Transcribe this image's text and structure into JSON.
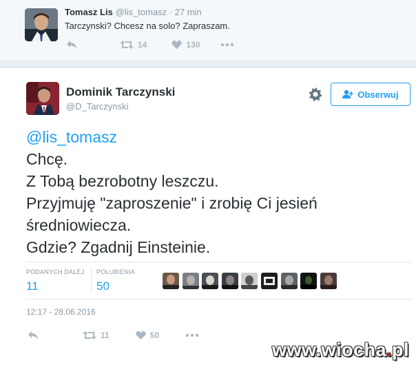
{
  "reply_tweet": {
    "author_name": "Tomasz Lis",
    "author_handle": "@lis_tomasz",
    "time": "· 27 min",
    "text": "Tarczynski? Chcesz na solo? Zapraszam.",
    "retweets": "14",
    "likes": "130"
  },
  "main_tweet": {
    "author_name": "Dominik Tarczynski",
    "author_handle": "@D_Tarczynski",
    "follow_label": "Obserwuj",
    "mention": "@lis_tomasz",
    "lines": [
      "Chcę.",
      "Z Tobą bezrobotny leszczu.",
      "Przyjmuję \"zaproszenie\" i zrobię Ci jesień",
      "średniowiecza.",
      "Gdzie? Zgadnij Einsteinie."
    ],
    "stats": {
      "retweets_label": "PODANYCH DALEJ",
      "retweets_value": "11",
      "likes_label": "POLUBIENIA",
      "likes_value": "50"
    },
    "timestamp": "12:17 - 28.06.2016",
    "action_retweets": "11",
    "action_likes": "50"
  },
  "liker_avatars": [
    "avatar-1",
    "avatar-2",
    "avatar-3",
    "avatar-4",
    "avatar-5",
    "avatar-6",
    "avatar-7",
    "avatar-8",
    "avatar-9"
  ],
  "watermark": {
    "brand": "www.wiocha",
    "dot": ".",
    "tld": "pl"
  },
  "colors": {
    "accent": "#1da1f2",
    "muted": "#8899a6",
    "icon": "#aab8c2",
    "text": "#292f33"
  }
}
